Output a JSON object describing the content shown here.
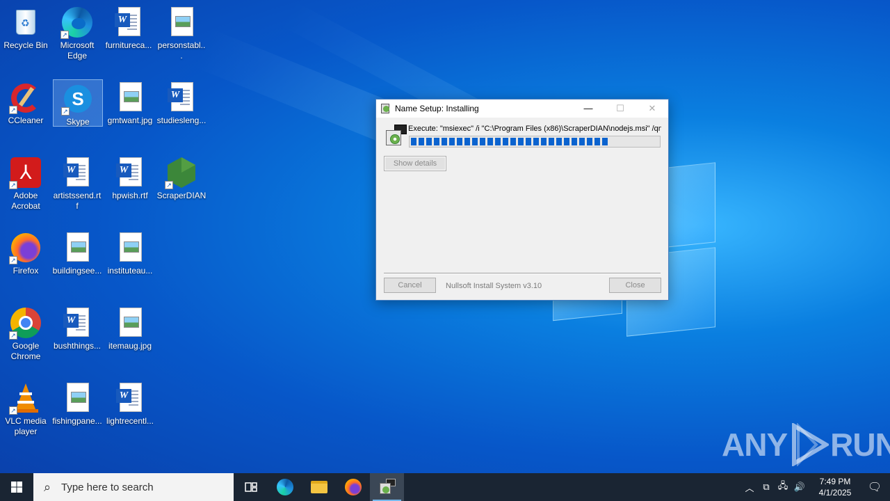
{
  "desktop": {
    "icons": [
      {
        "label": "Recycle Bin",
        "icon": "recycle-bin-icon"
      },
      {
        "label": "Microsoft Edge",
        "icon": "edge-icon"
      },
      {
        "label": "furniturecа...",
        "icon": "word-doc-icon"
      },
      {
        "label": "personstabl...",
        "icon": "image-file-icon"
      },
      {
        "label": "CCleaner",
        "icon": "ccleaner-icon"
      },
      {
        "label": "Skype",
        "icon": "skype-icon"
      },
      {
        "label": "gmtwant.jpg",
        "icon": "image-file-icon"
      },
      {
        "label": "studiesleng...",
        "icon": "word-doc-icon"
      },
      {
        "label": "Adobe Acrobat",
        "icon": "acrobat-icon"
      },
      {
        "label": "artistssend.rtf",
        "icon": "word-doc-icon"
      },
      {
        "label": "hpwish.rtf",
        "icon": "word-doc-icon"
      },
      {
        "label": "ScraperDIAN",
        "icon": "nodejs-icon"
      },
      {
        "label": "Firefox",
        "icon": "firefox-icon"
      },
      {
        "label": "buildingsee...",
        "icon": "image-file-icon"
      },
      {
        "label": "instituteau...",
        "icon": "image-file-icon"
      },
      {
        "label": "Google Chrome",
        "icon": "chrome-icon"
      },
      {
        "label": "bushthings...",
        "icon": "word-doc-icon"
      },
      {
        "label": "itemaug.jpg",
        "icon": "image-file-icon"
      },
      {
        "label": "VLC media player",
        "icon": "vlc-icon"
      },
      {
        "label": "fishingpane...",
        "icon": "image-file-icon"
      },
      {
        "label": "lightrecentl...",
        "icon": "word-doc-icon"
      }
    ]
  },
  "installer": {
    "title": "Name Setup: Installing",
    "exec_text": "Execute: \"msiexec\" /i \"C:\\Program Files (x86)\\ScraperDIAN\\nodejs.msi\" /qn",
    "progress_fraction": 0.8,
    "show_details_label": "Show details",
    "cancel_label": "Cancel",
    "close_label": "Close",
    "brand_text": "Nullsoft Install System v3.10"
  },
  "watermark": {
    "left": "ANY",
    "right": "RUN"
  },
  "taskbar": {
    "search_placeholder": "Type here to search",
    "time": "7:49 PM",
    "date": "4/1/2025"
  },
  "colors": {
    "accent": "#0078d7",
    "progress": "#0b63cf",
    "taskbar": "#1a2533"
  }
}
